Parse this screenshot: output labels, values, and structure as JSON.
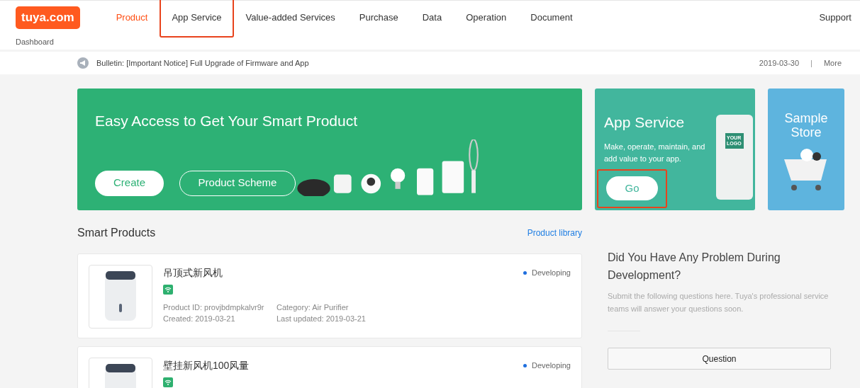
{
  "header": {
    "logo": "tuya.com",
    "nav": [
      {
        "label": "Product",
        "selected": true,
        "highlighted": false
      },
      {
        "label": "App Service",
        "selected": false,
        "highlighted": true
      },
      {
        "label": "Value-added Services",
        "selected": false,
        "highlighted": false
      },
      {
        "label": "Purchase",
        "selected": false,
        "highlighted": false
      },
      {
        "label": "Data",
        "selected": false,
        "highlighted": false
      },
      {
        "label": "Operation",
        "selected": false,
        "highlighted": false
      },
      {
        "label": "Document",
        "selected": false,
        "highlighted": false
      }
    ],
    "support": "Support",
    "breadcrumb": "Dashboard"
  },
  "bulletin": {
    "text": "Bulletin: [Important Notice] Full Upgrade of Firmware and App",
    "date": "2019-03-30",
    "separator": "|",
    "more": "More"
  },
  "banner": {
    "title": "Easy Access to Get Your Smart Product",
    "buttons": [
      "Create",
      "Product Scheme"
    ]
  },
  "app_service": {
    "title": "App Service",
    "text": "Make, operate, maintain, and add value to your app.",
    "logo_text": "YOUR LOGO",
    "button": "Go",
    "highlighted": true
  },
  "sample_store": {
    "title": "Sample Store"
  },
  "products": {
    "title": "Smart Products",
    "link": "Product library",
    "items": [
      {
        "name": "吊顶式新风机",
        "status": "Developing",
        "color": "#1f6fde",
        "product_id": "Product ID: provjbdmpkalvr9r",
        "category": "Category: Air Purifier",
        "created": "Created: 2019-03-21",
        "updated": "Last updated: 2019-03-21"
      },
      {
        "name": "壁挂新风机100风量",
        "status": "Developing",
        "color": "#1f6fde"
      }
    ]
  },
  "help": {
    "title": "Did You Have Any Problem During Development?",
    "text": "Submit the following questions here. Tuya's professional service teams will answer your questions soon.",
    "button": "Question"
  }
}
